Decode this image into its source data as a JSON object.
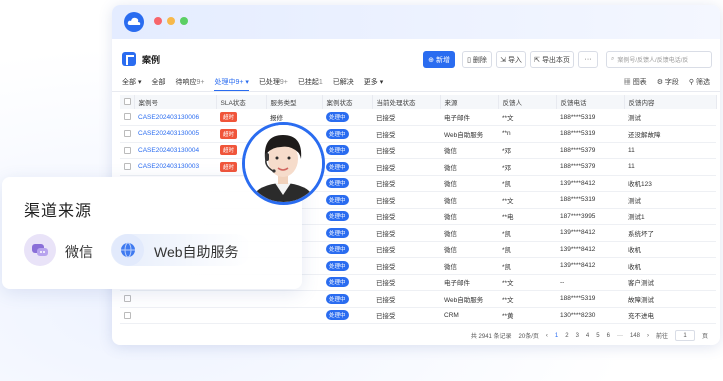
{
  "app": {
    "title": "案例"
  },
  "toolbar": {
    "new_label": "新增",
    "delete_label": "删除",
    "import_label": "导入",
    "export_label": "导出本页",
    "more_label": "···",
    "search_placeholder": "案例号/反馈人/反馈电话/反"
  },
  "tabs": [
    {
      "label": "全部",
      "count": "",
      "has_arrow": true
    },
    {
      "label": "全部",
      "count": "",
      "has_arrow": false
    },
    {
      "label": "待响应",
      "count": "9+",
      "has_arrow": false
    },
    {
      "label": "处理中",
      "count": "9+",
      "has_arrow": true
    },
    {
      "label": "已处理",
      "count": "9+",
      "has_arrow": false
    },
    {
      "label": "已挂起",
      "count": "1",
      "has_arrow": false
    },
    {
      "label": "已解决",
      "count": "",
      "has_arrow": false
    },
    {
      "label": "更多",
      "count": "",
      "has_arrow": true
    }
  ],
  "tools": {
    "chart": "图表",
    "fields": "字段",
    "filter": "筛选"
  },
  "table": {
    "columns": [
      "案例号",
      "SLA状态",
      "服务类型",
      "案例状态",
      "当前处理状态",
      "来源",
      "反馈人",
      "反馈电话",
      "反馈内容"
    ],
    "rows": [
      [
        "CASE202403130006",
        "超时",
        "报修",
        "处理中",
        "已接受",
        "电子邮件",
        "**文",
        "188****5319",
        "测试"
      ],
      [
        "CASE202403130005",
        "超时",
        "",
        "处理中",
        "已接受",
        "Web自助服务",
        "**n",
        "188****5319",
        "还没解故障"
      ],
      [
        "CASE202403130004",
        "超时",
        "",
        "处理中",
        "已接受",
        "微信",
        "*邓",
        "188****5379",
        "11"
      ],
      [
        "CASE202403130003",
        "超时",
        "",
        "处理中",
        "已接受",
        "微信",
        "*邓",
        "188****5379",
        "11"
      ],
      [
        "",
        "",
        "",
        "处理中",
        "已接受",
        "微信",
        "*凯",
        "139****8412",
        "收机123"
      ],
      [
        "",
        "",
        "",
        "处理中",
        "已接受",
        "微信",
        "**文",
        "188****5319",
        "测试"
      ],
      [
        "",
        "",
        "",
        "处理中",
        "已接受",
        "微信",
        "**电",
        "187****3995",
        "测试1"
      ],
      [
        "",
        "",
        "",
        "处理中",
        "已接受",
        "微信",
        "*凯",
        "139****8412",
        "系统坏了"
      ],
      [
        "",
        "",
        "",
        "处理中",
        "已接受",
        "微信",
        "*凯",
        "139****8412",
        "收机"
      ],
      [
        "",
        "",
        "",
        "处理中",
        "已接受",
        "微信",
        "*凯",
        "139****8412",
        "收机"
      ],
      [
        "",
        "",
        "",
        "处理中",
        "已接受",
        "电子邮件",
        "**文",
        "--",
        "客户测试"
      ],
      [
        "",
        "",
        "",
        "处理中",
        "已接受",
        "Web自助服务",
        "**文",
        "188****5319",
        "故障测试"
      ],
      [
        "",
        "",
        "",
        "处理中",
        "已接受",
        "CRM",
        "**黄",
        "130****8230",
        "充不进电"
      ]
    ]
  },
  "pager": {
    "total": "共 2941 条记录",
    "page_size": "20条/页",
    "pages": [
      "‹",
      "1",
      "2",
      "3",
      "4",
      "5",
      "6",
      "···",
      "148",
      "›"
    ],
    "goto_label": "前往",
    "goto_value": "1",
    "goto_suffix": "页"
  },
  "channel_card": {
    "title": "渠道来源",
    "channels": [
      {
        "label": "微信"
      },
      {
        "label": "Web自助服务"
      }
    ]
  },
  "colors": {
    "accent": "#2a6cf0",
    "sla_overdue": "#f0553a"
  }
}
